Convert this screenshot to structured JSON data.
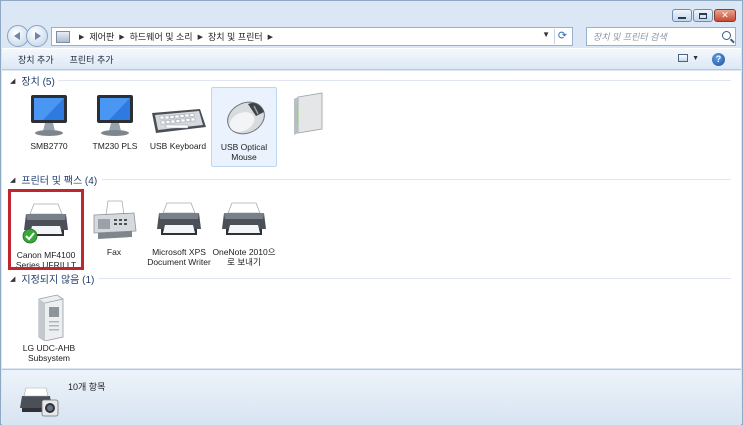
{
  "window": {
    "breadcrumb": [
      "제어판",
      "하드웨어 및 소리",
      "장치 및 프린터"
    ],
    "search_placeholder": "장치 및 프린터 검색"
  },
  "toolbar": {
    "add_device": "장치 추가",
    "add_printer": "프린터 추가"
  },
  "groups": {
    "devices": {
      "title": "장치 (5)",
      "items": [
        {
          "label": "SMB2770",
          "icon": "monitor-icon"
        },
        {
          "label": "TM230 PLS",
          "icon": "monitor-icon"
        },
        {
          "label": "USB Keyboard",
          "icon": "keyboard-icon"
        },
        {
          "label": "USB Optical Mouse",
          "icon": "mouse-icon"
        },
        {
          "label": "",
          "icon": "computer-tower-icon"
        }
      ]
    },
    "printers": {
      "title": "프린터 및 팩스 (4)",
      "items": [
        {
          "label": "Canon MF4100 Series UFRII LT",
          "icon": "printer-icon",
          "default": true
        },
        {
          "label": "Fax",
          "icon": "fax-icon"
        },
        {
          "label": "Microsoft XPS Document Writer",
          "icon": "printer-icon"
        },
        {
          "label": "OneNote 2010으로 보내기",
          "icon": "printer-icon"
        }
      ]
    },
    "unspecified": {
      "title": "지정되지 않음 (1)",
      "items": [
        {
          "label": "LG UDC-AHB Subsystem",
          "icon": "server-icon"
        }
      ]
    }
  },
  "status": {
    "count": "10개 항목"
  },
  "colors": {
    "highlight": "#c0272d",
    "default_check": "#3aa83a"
  }
}
